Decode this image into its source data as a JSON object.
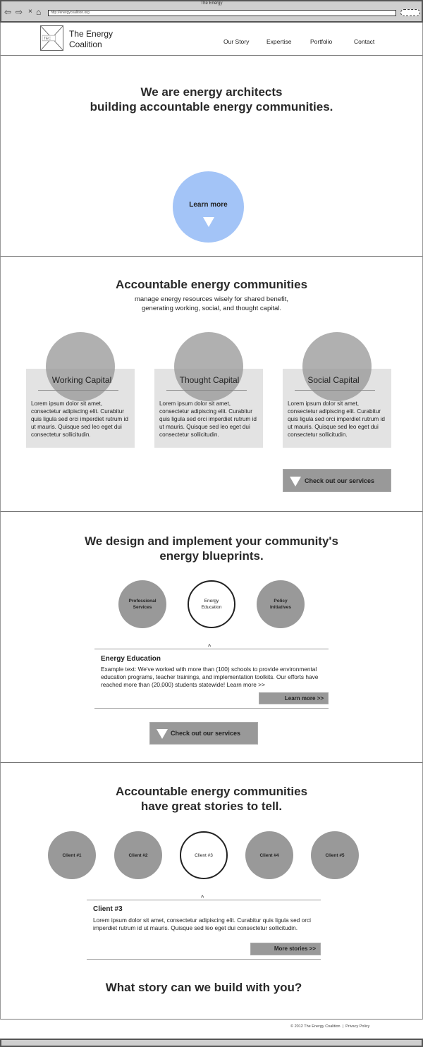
{
  "browser": {
    "title": "The Energy",
    "url": "http://energycoalition.org"
  },
  "header": {
    "logo_text": "TEC",
    "brand_line1": "The Energy",
    "brand_line2": "Coalition",
    "nav": [
      "Our Story",
      "Expertise",
      "Portfolio",
      "Contact"
    ]
  },
  "hero": {
    "line1": "We are energy architects",
    "line2": "building accountable energy communities.",
    "cta": "Learn more",
    "hero_color": "#a3c4f7"
  },
  "communities": {
    "title": "Accountable energy communities",
    "sub1": "manage energy resources wisely for shared benefit,",
    "sub2": "generating working, social, and thought capital.",
    "cards": [
      {
        "title": "Working Capital",
        "body": "Lorem ipsum dolor sit amet, consectetur adipiscing elit. Curabitur quis ligula sed orci imperdiet rutrum id ut mauris. Quisque sed leo eget dui consectetur sollicitudin."
      },
      {
        "title": "Thought Capital",
        "body": "Lorem ipsum dolor sit amet, consectetur adipiscing elit. Curabitur quis ligula sed orci imperdiet rutrum id ut mauris. Quisque sed leo eget dui consectetur sollicitudin."
      },
      {
        "title": "Social Capital",
        "body": "Lorem ipsum dolor sit amet, consectetur adipiscing elit. Curabitur quis ligula sed orci imperdiet rutrum id ut mauris. Quisque sed leo eget dui consectetur sollicitudin."
      }
    ],
    "button": "Check out our services"
  },
  "services": {
    "title1": "We design and implement your community's",
    "title2": "energy blueprints.",
    "items": [
      {
        "l1": "Professional",
        "l2": "Services"
      },
      {
        "l1": "Energy",
        "l2": "Education"
      },
      {
        "l1": "Policy",
        "l2": "Initiatives"
      }
    ],
    "caret": "^",
    "panel_title": "Energy Education",
    "panel_text": "Example text: We've worked with more than (100) schools to provide environmental education programs, teacher trainings, and implementation toolkits. Our efforts have reached more than (20,000) students statewide! Learn more >>",
    "panel_button": "Learn more >>",
    "button": "Check out our services"
  },
  "stories": {
    "title1": "Accountable energy communities",
    "title2": "have great stories to tell.",
    "clients": [
      "Client #1",
      "Client #2",
      "Client #3",
      "Client #4",
      "Client #5"
    ],
    "caret": "^",
    "panel_title": "Client #3",
    "panel_text": "Lorem ipsum dolor sit amet, consectetur adipiscing elit. Curabitur quis ligula sed orci imperdiet rutrum id ut mauris. Quisque sed leo eget dui consectetur sollicitudin.",
    "panel_button": "More stories >>",
    "cta_heading": "What story can we build with you?"
  },
  "footer": {
    "copyright": "© 2012 The Energy Coalition",
    "sep": "|",
    "privacy": "Privacy Policy"
  }
}
